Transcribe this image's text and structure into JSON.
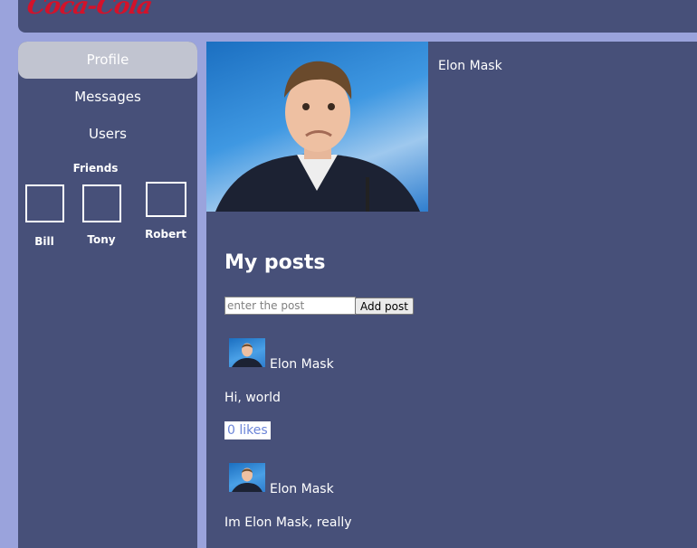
{
  "header": {
    "logo_text": "Coca-Cola"
  },
  "sidebar": {
    "items": [
      {
        "label": "Profile",
        "active": true
      },
      {
        "label": "Messages"
      },
      {
        "label": "Users"
      }
    ],
    "friends_title": "Friends",
    "friends": [
      {
        "name": "Bill"
      },
      {
        "name": "Tony"
      },
      {
        "name": "Robert"
      }
    ]
  },
  "profile": {
    "name": "Elon Mask"
  },
  "posts": {
    "title": "My posts",
    "input_placeholder": "enter the post",
    "add_button": "Add post",
    "items": [
      {
        "author": "Elon Mask",
        "text": "Hi, world",
        "likes": "0 likes"
      },
      {
        "author": "Elon Mask",
        "text": "Im Elon Mask, really"
      }
    ]
  },
  "colors": {
    "page_bg": "#9aa3dc",
    "panel_bg": "#475079",
    "active_nav": "#c1c4d0",
    "logo": "#d3122a",
    "likes_text": "#6b84d8"
  }
}
